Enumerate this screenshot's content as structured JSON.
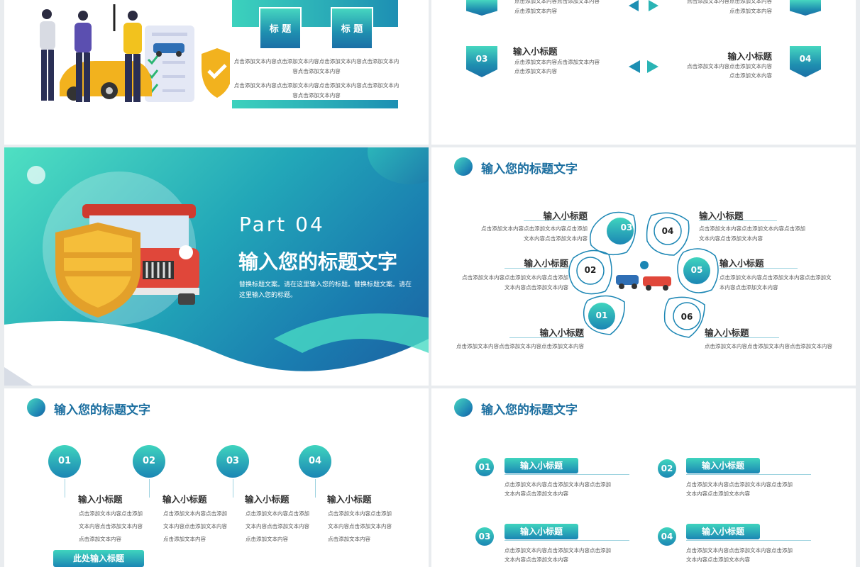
{
  "slide1": {
    "box_labels": [
      "标 题",
      "标 题"
    ],
    "para1": "点击添加文本内容点击添加文本内容点击添加文本内容点击添加文本内容点击添加文本内容",
    "para2": "点击添加文本内容点击添加文本内容点击添加文本内容点击添加文本内容点击添加文本内容"
  },
  "slide2": {
    "top_left_text": "点击添加文本内容点击添加文本内容",
    "top_left_text2": "点击添加文本内容",
    "top_right_text": "点击添加文本内容点击添加文本内容",
    "top_right_text2": "点击添加文本内容",
    "item3": {
      "num": "03",
      "title": "输入小标题",
      "text1": "点击添加文本内容点击添加文本内容",
      "text2": "点击添加文本内容"
    },
    "item4": {
      "num": "04",
      "title": "输入小标题",
      "text1": "点击添加文本内容点击添加文本内容",
      "text2": "点击添加文本内容"
    }
  },
  "slide3": {
    "part": "Part  04",
    "title": "输入您的标题文字",
    "desc1": "替换标题文案。请在这里输入您的标题。替换标题文案。请在",
    "desc2": "这里输入您的标题。"
  },
  "slide4": {
    "header": "输入您的标题文字",
    "items": [
      {
        "num": "01",
        "title": "输入小标题",
        "text1": "点击添加文本内容点击添加文本内容点击添加文本内容",
        "text2": ""
      },
      {
        "num": "02",
        "title": "输入小标题",
        "text1": "点击添加文本内容点击添加文本内容点击添加",
        "text2": "文本内容点击添加文本内容"
      },
      {
        "num": "03",
        "title": "输入小标题",
        "text1": "点击添加文本内容点击添加文本内容点击添加",
        "text2": "文本内容点击添加文本内容"
      },
      {
        "num": "04",
        "title": "输入小标题",
        "text1": "点击添加文本内容点击添加文本内容点击添加",
        "text2": "文本内容点击添加文本内容"
      },
      {
        "num": "05",
        "title": "输入小标题",
        "text1": "点击添加文本内容点击添加文本内容点击添加文",
        "text2": "本内容点击添加文本内容"
      },
      {
        "num": "06",
        "title": "输入小标题",
        "text1": "点击添加文本内容点击添加文本内容点击添加文本内容",
        "text2": ""
      }
    ]
  },
  "slide5": {
    "header": "输入您的标题文字",
    "items": [
      {
        "num": "01",
        "title": "输入小标题",
        "l1": "点击添加文本内容点击添加",
        "l2": "文本内容点击添加文本内容",
        "l3": "点击添加文本内容"
      },
      {
        "num": "02",
        "title": "输入小标题",
        "l1": "点击添加文本内容点击添加",
        "l2": "文本内容点击添加文本内容",
        "l3": "点击添加文本内容"
      },
      {
        "num": "03",
        "title": "输入小标题",
        "l1": "点击添加文本内容点击添加",
        "l2": "文本内容点击添加文本内容",
        "l3": "点击添加文本内容"
      },
      {
        "num": "04",
        "title": "输入小标题",
        "l1": "点击添加文本内容点击添加",
        "l2": "文本内容点击添加文本内容",
        "l3": "点击添加文本内容"
      }
    ],
    "button": "此处输入标题"
  },
  "slide6": {
    "header": "输入您的标题文字",
    "items": [
      {
        "num": "01",
        "title": "输入小标题",
        "l1": "点击添加文本内容点击添加文本内容点击添加",
        "l2": "文本内容点击添加文本内容"
      },
      {
        "num": "02",
        "title": "输入小标题",
        "l1": "点击添加文本内容点击添加文本内容点击添加",
        "l2": "文本内容点击添加文本内容"
      },
      {
        "num": "03",
        "title": "输入小标题",
        "l1": "点击添加文本内容点击添加文本内容点击添加",
        "l2": "文本内容点击添加文本内容"
      },
      {
        "num": "04",
        "title": "输入小标题",
        "l1": "点击添加文本内容点击添加文本内容点击添加",
        "l2": "文本内容点击添加文本内容"
      }
    ]
  },
  "colors": {
    "accent": "#1c6fa0",
    "teal": "#3cd2bd",
    "blue": "#1b86b4"
  }
}
